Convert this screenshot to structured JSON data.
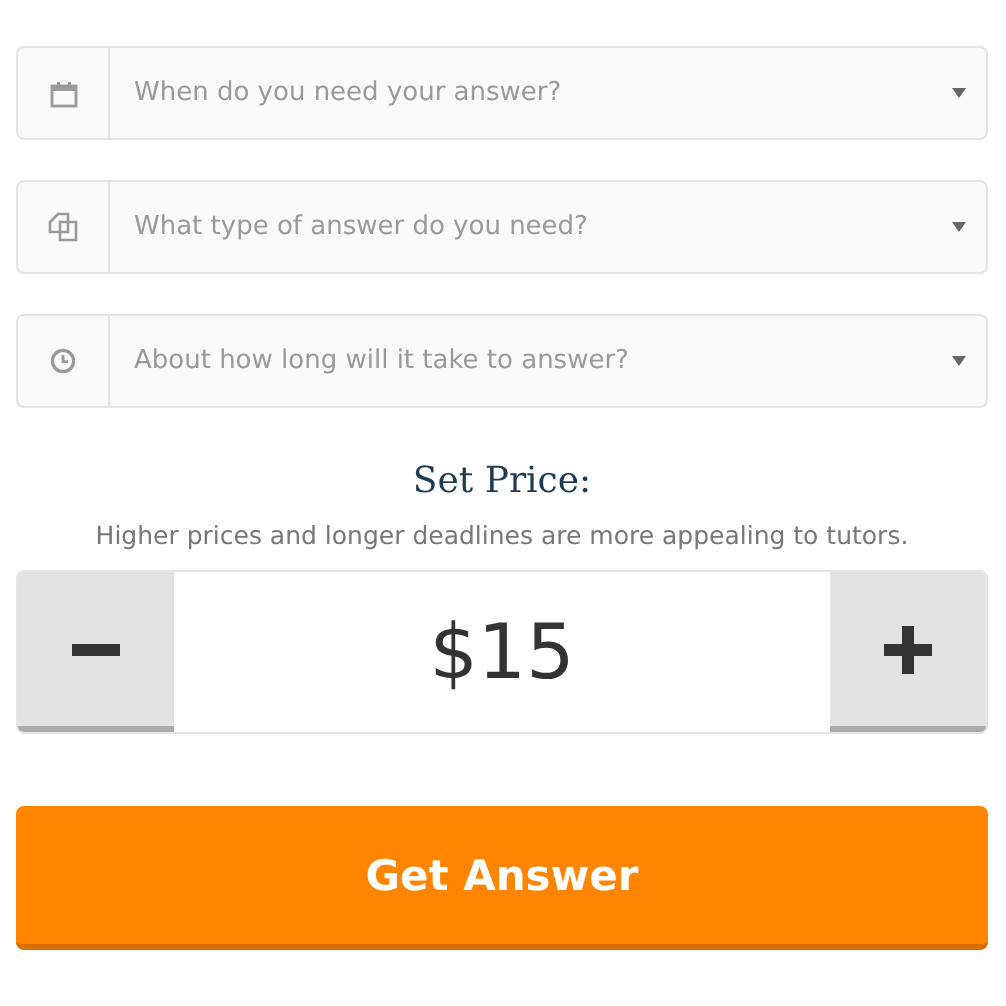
{
  "selects": [
    {
      "placeholder": "When do you need your answer?"
    },
    {
      "placeholder": "What type of answer do you need?"
    },
    {
      "placeholder": "About how long will it take to answer?"
    }
  ],
  "price": {
    "title": "Set Price:",
    "hint": "Higher prices and longer deadlines are more appealing to tutors.",
    "value": "$15"
  },
  "submit": {
    "label": "Get Answer"
  }
}
